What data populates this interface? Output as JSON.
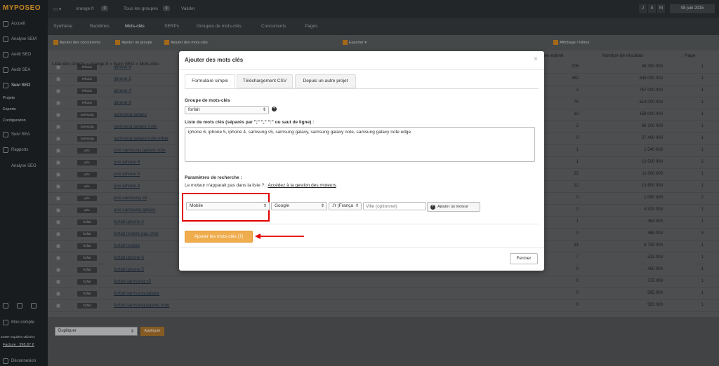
{
  "app": {
    "logo": "MYPOSEO"
  },
  "topbar": {
    "project": "orange.fr",
    "groups": "Tous les groupes",
    "validate": "Valider",
    "size_buttons": [
      "J",
      "S",
      "M"
    ],
    "date": "08 juin 2015"
  },
  "sidebar": {
    "items": [
      {
        "label": "Accueil"
      },
      {
        "label": "Analyse SEM"
      },
      {
        "label": "Audit SEO"
      },
      {
        "label": "Audit SEA"
      },
      {
        "label": "Suivi SEO"
      }
    ],
    "sub_items": [
      "Projets",
      "Exports",
      "Configuration"
    ],
    "items2": [
      {
        "label": "Suivi SEA"
      },
      {
        "label": "Rapports"
      },
      {
        "label": "Analyse SEO"
      }
    ],
    "account": "Mon compte",
    "requests": "23497 requêtes utilisées",
    "invoice": "Facture : 398,87 €",
    "logout": "Déconnexion"
  },
  "nav_tabs": [
    "Synthèse",
    "Backlinks",
    "Mots-clés",
    "SERPs",
    "Groupes de mots-clés",
    "Concurrents",
    "Pages"
  ],
  "toolbar": [
    "Ajouter des concurrents",
    "Ajouter un groupe",
    "Ajouter des mots-clés",
    "Affichage / Filtres",
    "Exporter"
  ],
  "breadcrumb": "Liste des projets » orange.fr » Suivi SEO » Mots-clés",
  "breadcrumb_badge": "Groupe mobile",
  "table_headers": [
    "Volume estimé",
    "Nombre de résultats",
    "Page"
  ],
  "bg_rows": [
    {
      "tag": "iPhone",
      "kw": "iphone 6",
      "v": "206",
      "r": "88 300 000",
      "p": "1"
    },
    {
      "tag": "iPhone",
      "kw": "iphone 5",
      "v": "452",
      "r": "638 000 000",
      "p": "1"
    },
    {
      "tag": "iPhone",
      "kw": "iphone 4",
      "v": "2",
      "r": "757 000 000",
      "p": "1"
    },
    {
      "tag": "iPhone",
      "kw": "iphone 6",
      "v": "75",
      "r": "614 000 000",
      "p": "1"
    },
    {
      "tag": "Samsung",
      "kw": "samsung galaxy",
      "v": "10",
      "r": "159 000 000",
      "p": "1"
    },
    {
      "tag": "Samsung",
      "kw": "samsung galaxy note",
      "v": "2",
      "r": "88 100 000",
      "p": "1"
    },
    {
      "tag": "Samsung",
      "kw": "samsung galaxy note edge",
      "v": "0",
      "r": "27 400 000",
      "p": "1"
    },
    {
      "tag": "prix",
      "kw": "prix samsung galaxy note",
      "v": "1",
      "r": "1 540 000",
      "p": "1"
    },
    {
      "tag": "prix",
      "kw": "prix iphone 6",
      "v": "1",
      "r": "10 500 000",
      "p": "2"
    },
    {
      "tag": "prix",
      "kw": "prix iphone 5",
      "v": "22",
      "r": "11 600 000",
      "p": "1"
    },
    {
      "tag": "prix",
      "kw": "prix iphone 4",
      "v": "12",
      "r": "13 800 000",
      "p": "1"
    },
    {
      "tag": "prix",
      "kw": "prix samsung s5",
      "v": "0",
      "r": "1 080 000",
      "p": "2"
    },
    {
      "tag": "prix",
      "kw": "prix samsung galaxy",
      "v": "0",
      "r": "4 520 000",
      "p": "1"
    },
    {
      "tag": "forfait",
      "kw": "forfait iphone 4",
      "v": "1",
      "r": "454 000",
      "p": "1"
    },
    {
      "tag": "forfait",
      "kw": "forfait mobile pas cher",
      "v": "0",
      "r": "468 000",
      "p": "3"
    },
    {
      "tag": "forfait",
      "kw": "forfait mobile",
      "v": "14",
      "r": "8 730 000",
      "p": "1"
    },
    {
      "tag": "forfait",
      "kw": "forfait iphone 6",
      "v": "7",
      "r": "513 000",
      "p": "1"
    },
    {
      "tag": "forfait",
      "kw": "forfait iphone 5",
      "v": "0",
      "r": "450 000",
      "p": "1"
    },
    {
      "tag": "forfait",
      "kw": "forfait samsung s5",
      "v": "0",
      "r": "375 000",
      "p": "1"
    },
    {
      "tag": "forfait",
      "kw": "forfait samsung galaxy",
      "v": "0",
      "r": "565 000",
      "p": "1"
    },
    {
      "tag": "forfait",
      "kw": "forfait samsung galaxy note",
      "v": "0",
      "r": "563 000",
      "p": "1"
    }
  ],
  "bottom": {
    "duplicate": "Dupliquer",
    "apply": "Appliquer"
  },
  "modal": {
    "title": "Ajouter des mots clés",
    "close_x": "×",
    "tabs": [
      "Formulaire simple",
      "Téléchargement CSV",
      "Depuis un autre projet"
    ],
    "group_label": "Groupe de mots-clés",
    "group_value": "forfait",
    "list_label": "Liste de mots clés (séparés par \";\" \",\" \":\" ou saut de ligne) :",
    "keywords": "iphone 6, iphone 5, iphone 4, samsung s5, samsung galaxy, samsung galaxy note, samsung galaxy note edge",
    "params_label": "Paramètres de recherche :",
    "engine_note": "Le moteur n'apparait pas dans la liste ? :",
    "engine_link": "Accédez à la gestion des moteurs",
    "device": "Mobile",
    "engine": "Google",
    "tld": ".fr (França",
    "city_placeholder": "Ville (optionnel)",
    "add_engine": "Ajouter un moteur",
    "submit": "Ajouter les mots-clés (7)",
    "close_button": "Fermer"
  },
  "colors": {
    "accent": "#f0ad4e",
    "highlight": "#e00000"
  }
}
